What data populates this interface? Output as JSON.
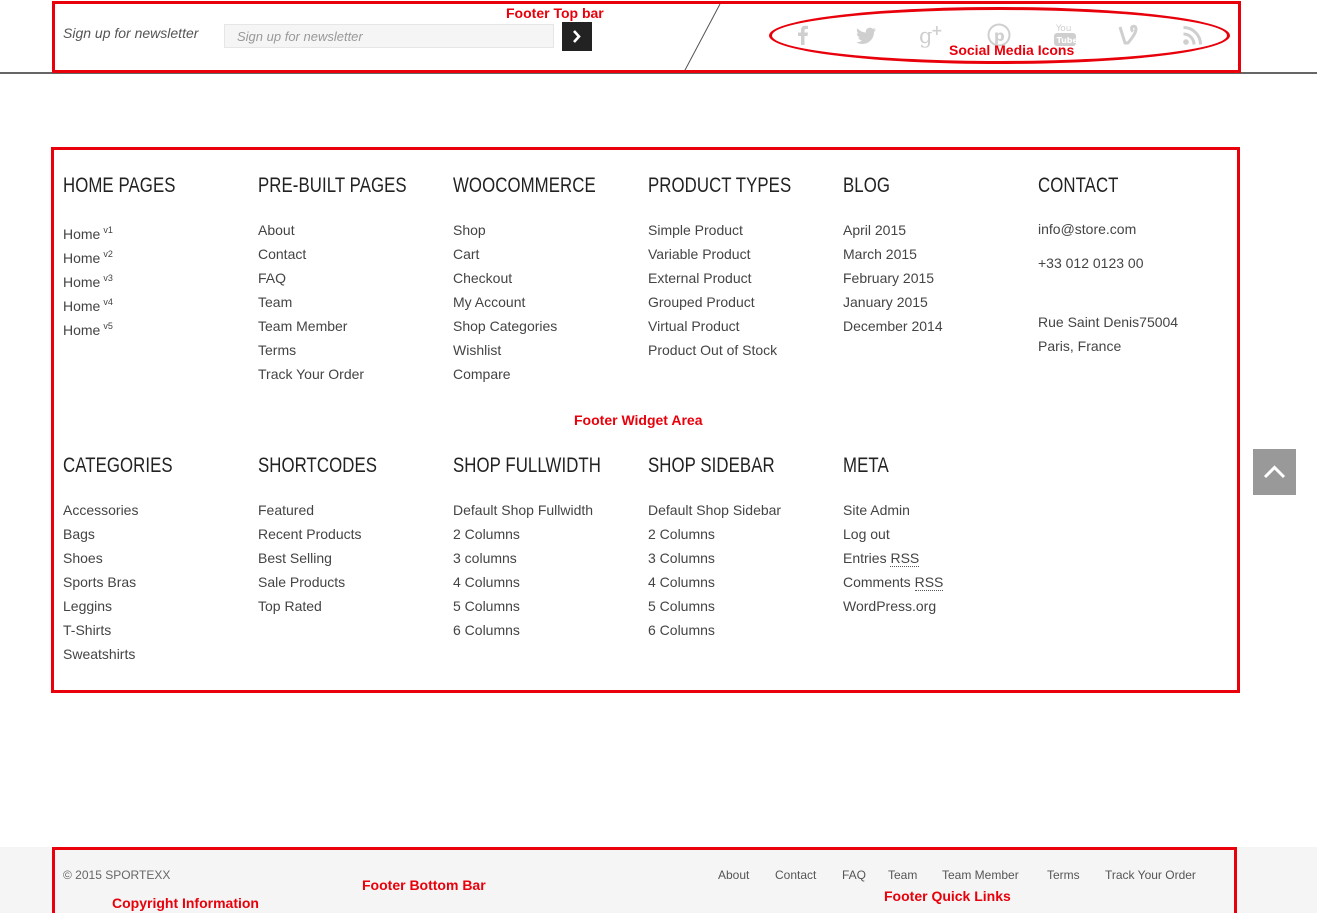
{
  "annotations": {
    "footer_top_bar": "Footer Top bar",
    "social_media_icons": "Social Media Icons",
    "footer_widget_area": "Footer Widget Area",
    "footer_bottom_bar": "Footer Bottom Bar",
    "copyright_information": "Copyright Information",
    "footer_quick_links": "Footer Quick Links",
    "color": "#e8000b"
  },
  "newsletter": {
    "label": "Sign up for newsletter",
    "placeholder": "Sign up for newsletter",
    "submit_icon": "chevron-right-icon"
  },
  "social_icons": [
    "facebook-icon",
    "twitter-icon",
    "google-plus-icon",
    "pinterest-icon",
    "youtube-icon",
    "vine-icon",
    "rss-icon"
  ],
  "widgets_row1": [
    {
      "title": "HOME PAGES",
      "items": [
        {
          "label": "Home",
          "sup": "v1"
        },
        {
          "label": "Home",
          "sup": "v2"
        },
        {
          "label": "Home",
          "sup": "v3"
        },
        {
          "label": "Home",
          "sup": "v4"
        },
        {
          "label": "Home",
          "sup": "v5"
        }
      ]
    },
    {
      "title": "PRE-BUILT PAGES",
      "items": [
        {
          "label": "About"
        },
        {
          "label": "Contact"
        },
        {
          "label": "FAQ"
        },
        {
          "label": "Team"
        },
        {
          "label": "Team Member"
        },
        {
          "label": "Terms"
        },
        {
          "label": "Track Your Order"
        }
      ]
    },
    {
      "title": "WOOCOMMERCE",
      "items": [
        {
          "label": "Shop"
        },
        {
          "label": "Cart"
        },
        {
          "label": "Checkout"
        },
        {
          "label": "My Account"
        },
        {
          "label": "Shop Categories"
        },
        {
          "label": "Wishlist"
        },
        {
          "label": "Compare"
        }
      ]
    },
    {
      "title": "PRODUCT TYPES",
      "items": [
        {
          "label": "Simple Product"
        },
        {
          "label": "Variable Product"
        },
        {
          "label": "External Product"
        },
        {
          "label": "Grouped Product"
        },
        {
          "label": "Virtual Product"
        },
        {
          "label": "Product Out of Stock"
        }
      ]
    },
    {
      "title": "BLOG",
      "items": [
        {
          "label": "April 2015"
        },
        {
          "label": "March 2015"
        },
        {
          "label": "February 2015"
        },
        {
          "label": "January 2015"
        },
        {
          "label": "December 2014"
        }
      ]
    }
  ],
  "contact": {
    "title": "CONTACT",
    "email": "info@store.com",
    "phone": "+33 012 0123 00",
    "address_line1": "Rue Saint Denis75004",
    "address_line2": "Paris, France"
  },
  "widgets_row2": [
    {
      "title": "CATEGORIES",
      "items": [
        {
          "label": "Accessories"
        },
        {
          "label": "Bags"
        },
        {
          "label": "Shoes"
        },
        {
          "label": "Sports Bras"
        },
        {
          "label": "Leggins"
        },
        {
          "label": "T-Shirts"
        },
        {
          "label": "Sweatshirts"
        }
      ]
    },
    {
      "title": "SHORTCODES",
      "items": [
        {
          "label": "Featured"
        },
        {
          "label": "Recent Products"
        },
        {
          "label": "Best Selling"
        },
        {
          "label": "Sale Products"
        },
        {
          "label": "Top Rated"
        }
      ]
    },
    {
      "title": "SHOP FULLWIDTH",
      "items": [
        {
          "label": "Default Shop Fullwidth"
        },
        {
          "label": "2 Columns"
        },
        {
          "label": "3 columns"
        },
        {
          "label": "4 Columns"
        },
        {
          "label": "5 Columns"
        },
        {
          "label": "6 Columns"
        }
      ]
    },
    {
      "title": "SHOP SIDEBAR",
      "items": [
        {
          "label": "Default Shop Sidebar"
        },
        {
          "label": "2 Columns"
        },
        {
          "label": "3 Columns"
        },
        {
          "label": "4 Columns"
        },
        {
          "label": "5 Columns"
        },
        {
          "label": "6 Columns"
        }
      ]
    },
    {
      "title": "META",
      "items": [
        {
          "label": "Site Admin"
        },
        {
          "label": "Log out"
        },
        {
          "label": "Entries ",
          "abbr": "RSS"
        },
        {
          "label": "Comments ",
          "abbr": "RSS"
        },
        {
          "label": "WordPress.org"
        }
      ]
    }
  ],
  "back_to_top_icon": "chevron-up-icon",
  "copyright": "© 2015 SPORTEXX",
  "quick_links": [
    "About",
    "Contact",
    "FAQ",
    "Team",
    "Team Member",
    "Terms",
    "Track Your Order"
  ]
}
